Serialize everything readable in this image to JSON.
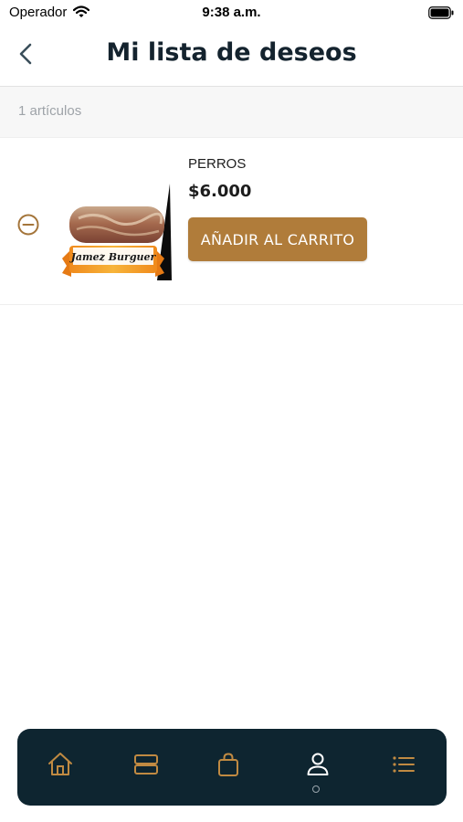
{
  "status_bar": {
    "carrier": "Operador",
    "time": "9:38 a.m."
  },
  "header": {
    "title": "Mi lista de deseos"
  },
  "wishlist": {
    "count_label": "1 artículos",
    "items": [
      {
        "name": "PERROS",
        "price": "$6.000",
        "add_to_cart_label": "AÑADIR AL CARRITO",
        "image_brand": "Jamez Burguer"
      }
    ]
  },
  "bottom_nav": {
    "items": [
      "home-icon",
      "categories-icon",
      "shopping-bag-icon",
      "profile-icon",
      "menu-list-icon"
    ],
    "active": "profile-icon"
  },
  "colors": {
    "accent": "#b07c3a",
    "nav_background": "#0e2530",
    "title": "#14232e",
    "muted_text": "#9ea3a8"
  }
}
